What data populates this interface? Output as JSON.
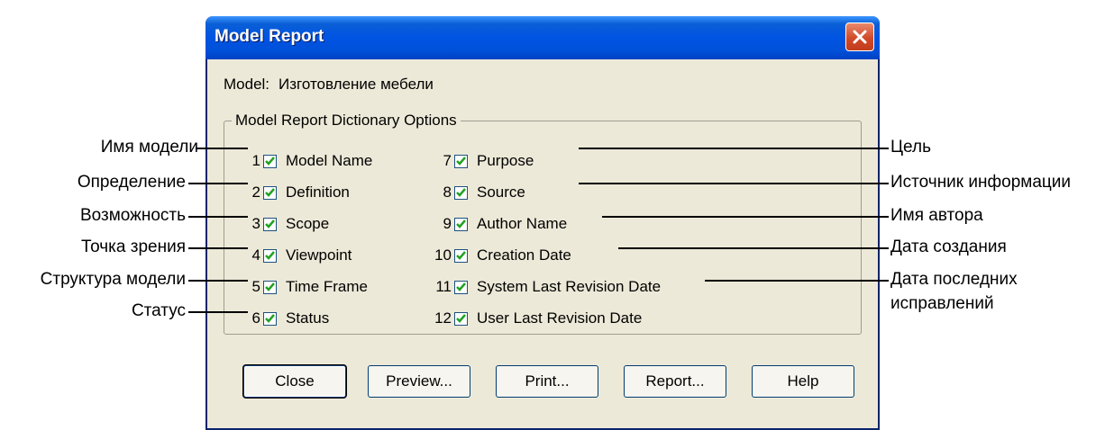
{
  "dialog": {
    "title": "Model Report",
    "model_label": "Model:",
    "model_value": "Изготовление мебели",
    "group_title": "Model Report Dictionary Options",
    "options_left": [
      {
        "num": "1",
        "label": "Model Name",
        "checked": true
      },
      {
        "num": "2",
        "label": "Definition",
        "checked": true
      },
      {
        "num": "3",
        "label": "Scope",
        "checked": true
      },
      {
        "num": "4",
        "label": "Viewpoint",
        "checked": true
      },
      {
        "num": "5",
        "label": "Time Frame",
        "checked": true
      },
      {
        "num": "6",
        "label": "Status",
        "checked": true
      }
    ],
    "options_right": [
      {
        "num": "7",
        "label": "Purpose",
        "checked": true
      },
      {
        "num": "8",
        "label": "Source",
        "checked": true
      },
      {
        "num": "9",
        "label": "Author Name",
        "checked": true
      },
      {
        "num": "10",
        "label": "Creation Date",
        "checked": true
      },
      {
        "num": "11",
        "label": "System Last Revision Date",
        "checked": true
      },
      {
        "num": "12",
        "label": "User Last Revision Date",
        "checked": true
      }
    ],
    "buttons": {
      "close": "Close",
      "preview": "Preview...",
      "print": "Print...",
      "report": "Report...",
      "help": "Help"
    }
  },
  "annotations": {
    "left": [
      "Имя модели",
      "Определение",
      "Возможность",
      "Точка зрения",
      "Структура модели",
      "Статус"
    ],
    "right": [
      "Цель",
      "Источник информации",
      "Имя автора",
      "Дата создания",
      "Дата последних",
      "исправлений"
    ]
  },
  "colors": {
    "title_bar": "#0054e3",
    "dialog_bg": "#ece9d8",
    "close_button": "#d04a2a"
  }
}
